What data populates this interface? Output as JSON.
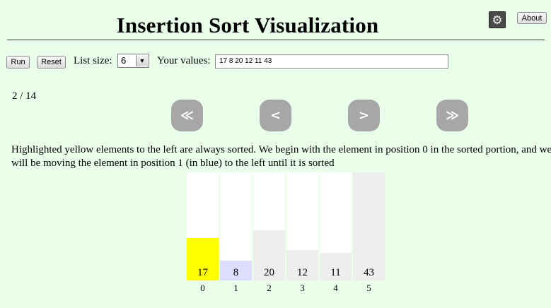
{
  "header": {
    "title": "Insertion Sort Visualization",
    "settings_icon": "gear-icon",
    "about_label": "About"
  },
  "controls": {
    "run_label": "Run",
    "reset_label": "Reset",
    "list_size_label": "List size:",
    "list_size_value": "6",
    "your_values_label": "Your values:",
    "your_values_value": "17 8 20 12 11 43"
  },
  "step": {
    "counter": "2 / 14"
  },
  "navigation": {
    "first_label": "≪",
    "prev_label": "<",
    "next_label": ">",
    "last_label": "≫"
  },
  "description": "Highlighted yellow elements to the left are always sorted. We begin with the element in position 0 in the sorted portion, and we will be moving the element in position 1 (in blue) to the left until it is sorted",
  "colors": {
    "background": "#eaffea",
    "sorted": "#ffff00",
    "current": "#ddddff",
    "unsorted": "#eeeeee",
    "nav_button": "#a7a7a7"
  },
  "bars": {
    "max_value": 43,
    "items": [
      {
        "index": "0",
        "value": 17,
        "state": "sorted"
      },
      {
        "index": "1",
        "value": 8,
        "state": "current"
      },
      {
        "index": "2",
        "value": 20,
        "state": "unsorted"
      },
      {
        "index": "3",
        "value": 12,
        "state": "unsorted"
      },
      {
        "index": "4",
        "value": 11,
        "state": "unsorted"
      },
      {
        "index": "5",
        "value": 43,
        "state": "unsorted"
      }
    ]
  }
}
